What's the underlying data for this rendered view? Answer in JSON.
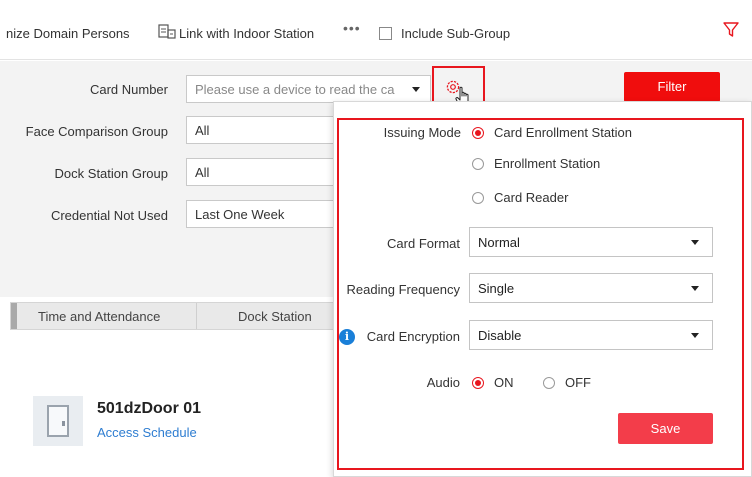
{
  "toolbar": {
    "sync_label": "nize Domain Persons",
    "link_indoor_label": "Link with Indoor Station",
    "more_label": "•••",
    "include_subgroup_label": "Include Sub-Group",
    "include_subgroup_checked": false
  },
  "filter_form": {
    "card_number_label": "Card Number",
    "card_number_placeholder": "Please use a device to read the ca",
    "face_group_label": "Face Comparison Group",
    "face_group_value": "All",
    "dock_group_label": "Dock Station Group",
    "dock_group_value": "All",
    "credential_label": "Credential Not Used",
    "credential_value": "Last One Week",
    "filter_button": "Filter"
  },
  "tabs": [
    "Time and Attendance",
    "Dock Station"
  ],
  "door": {
    "name": "501dzDoor 01",
    "link": "Access Schedule"
  },
  "popup": {
    "issuing_mode_label": "Issuing Mode",
    "issuing_options": [
      "Card Enrollment Station",
      "Enrollment Station",
      "Card Reader"
    ],
    "issuing_selected": "Card Enrollment Station",
    "card_format_label": "Card Format",
    "card_format_value": "Normal",
    "reading_frequency_label": "Reading Frequency",
    "reading_frequency_value": "Single",
    "card_encryption_label": "Card Encryption",
    "card_encryption_value": "Disable",
    "audio_label": "Audio",
    "audio_on": "ON",
    "audio_off": "OFF",
    "audio_selected": "ON",
    "save_button": "Save"
  },
  "colors": {
    "accent_red": "#e8161e",
    "button_red": "#f00d0d",
    "save_red": "#f33d4a",
    "link_blue": "#2e7dd1",
    "info_blue": "#1a7fd8"
  },
  "icons": [
    "link-indoor-station-icon",
    "more-icon",
    "filter-funnel-icon",
    "gear-icon",
    "pointer-hand-icon",
    "info-icon",
    "door-icon"
  ]
}
